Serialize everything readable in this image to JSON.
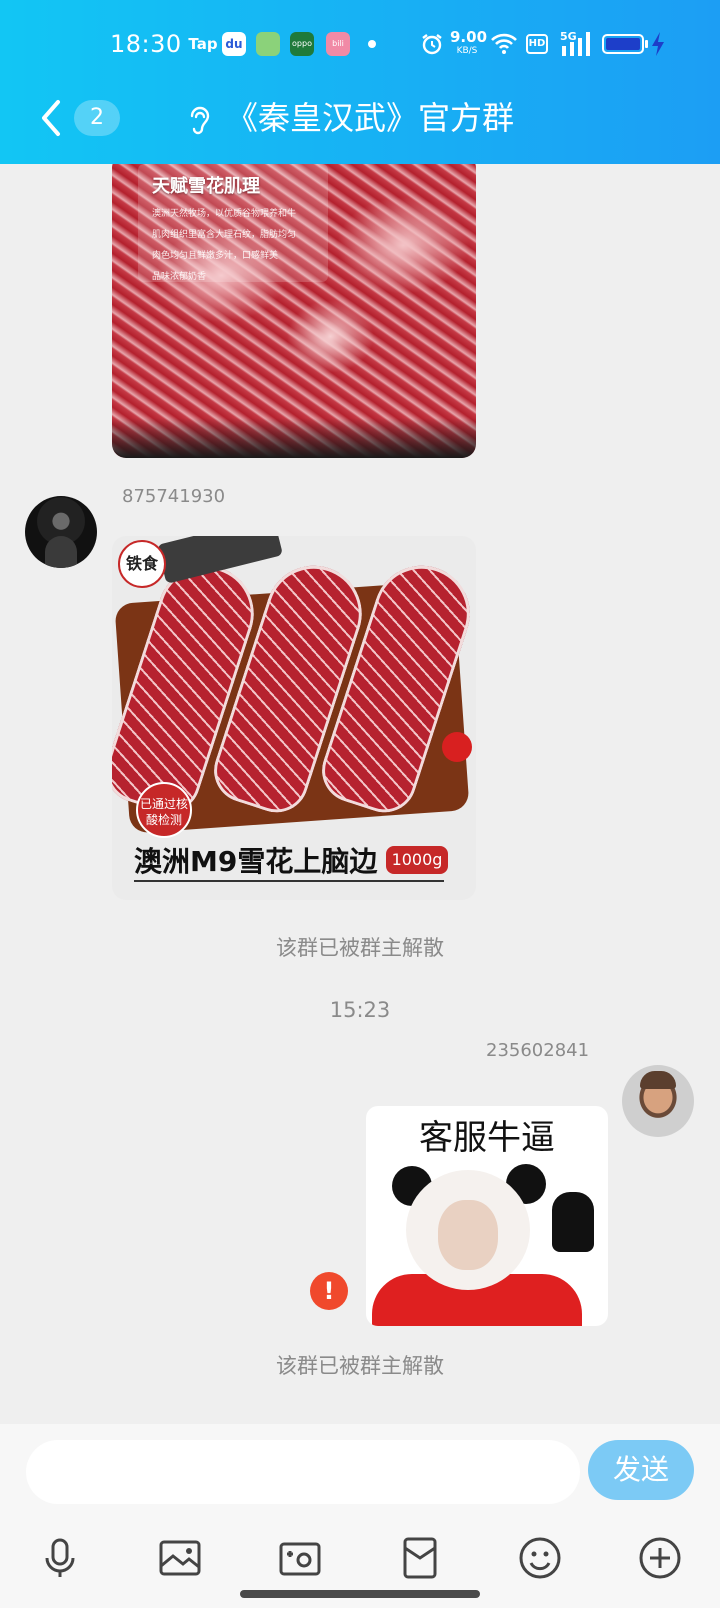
{
  "status_bar": {
    "time": "18:30",
    "tap_label": "Tap",
    "baidu_label": "du",
    "oppo_label": "oppo",
    "bili_label": "bili",
    "net_speed_value": "9.00",
    "net_speed_unit": "KB/S",
    "hd_label": "HD",
    "signal_label": "5G",
    "battery_level": 1.0
  },
  "header": {
    "back_icon": "chevron-left-icon",
    "unread_count": "2",
    "ear_icon": "ear-icon",
    "title": "《秦皇汉武》官方群"
  },
  "messages": {
    "image1": {
      "overlay_title": "天赋雪花肌理",
      "overlay_lines": [
        "澳洲天然牧场，以优质谷物喂养和牛",
        "肌肉组织里富含大理石纹，脂肪均匀",
        "肉色均匀且鲜嫩多汁，口感鲜美",
        "品味浓郁奶香"
      ]
    },
    "msg_a": {
      "sender": "875741930",
      "brand_logo_text": "铁食",
      "badge_text": "已通过核酸检测",
      "product_title": "澳洲M9雪花上脑边",
      "weight_tag": "1000g"
    },
    "note_dissolved_1": "该群已被群主解散",
    "timestamp": "15:23",
    "msg_b": {
      "sender": "235602841",
      "sticker_caption": "客服牛逼",
      "error_mark": "!"
    },
    "note_dissolved_2": "该群已被群主解散"
  },
  "input_area": {
    "input_value": "",
    "input_placeholder": "",
    "send_label": "发送",
    "toolbar_icons": [
      "microphone-icon",
      "gallery-icon",
      "camera-icon",
      "red-packet-icon",
      "emoji-icon",
      "plus-icon"
    ]
  },
  "colors": {
    "header_start": "#12c6f4",
    "header_end": "#1c9ef4",
    "send_button": "#7ccaf5",
    "error": "#f0492c",
    "background": "#efefef"
  }
}
